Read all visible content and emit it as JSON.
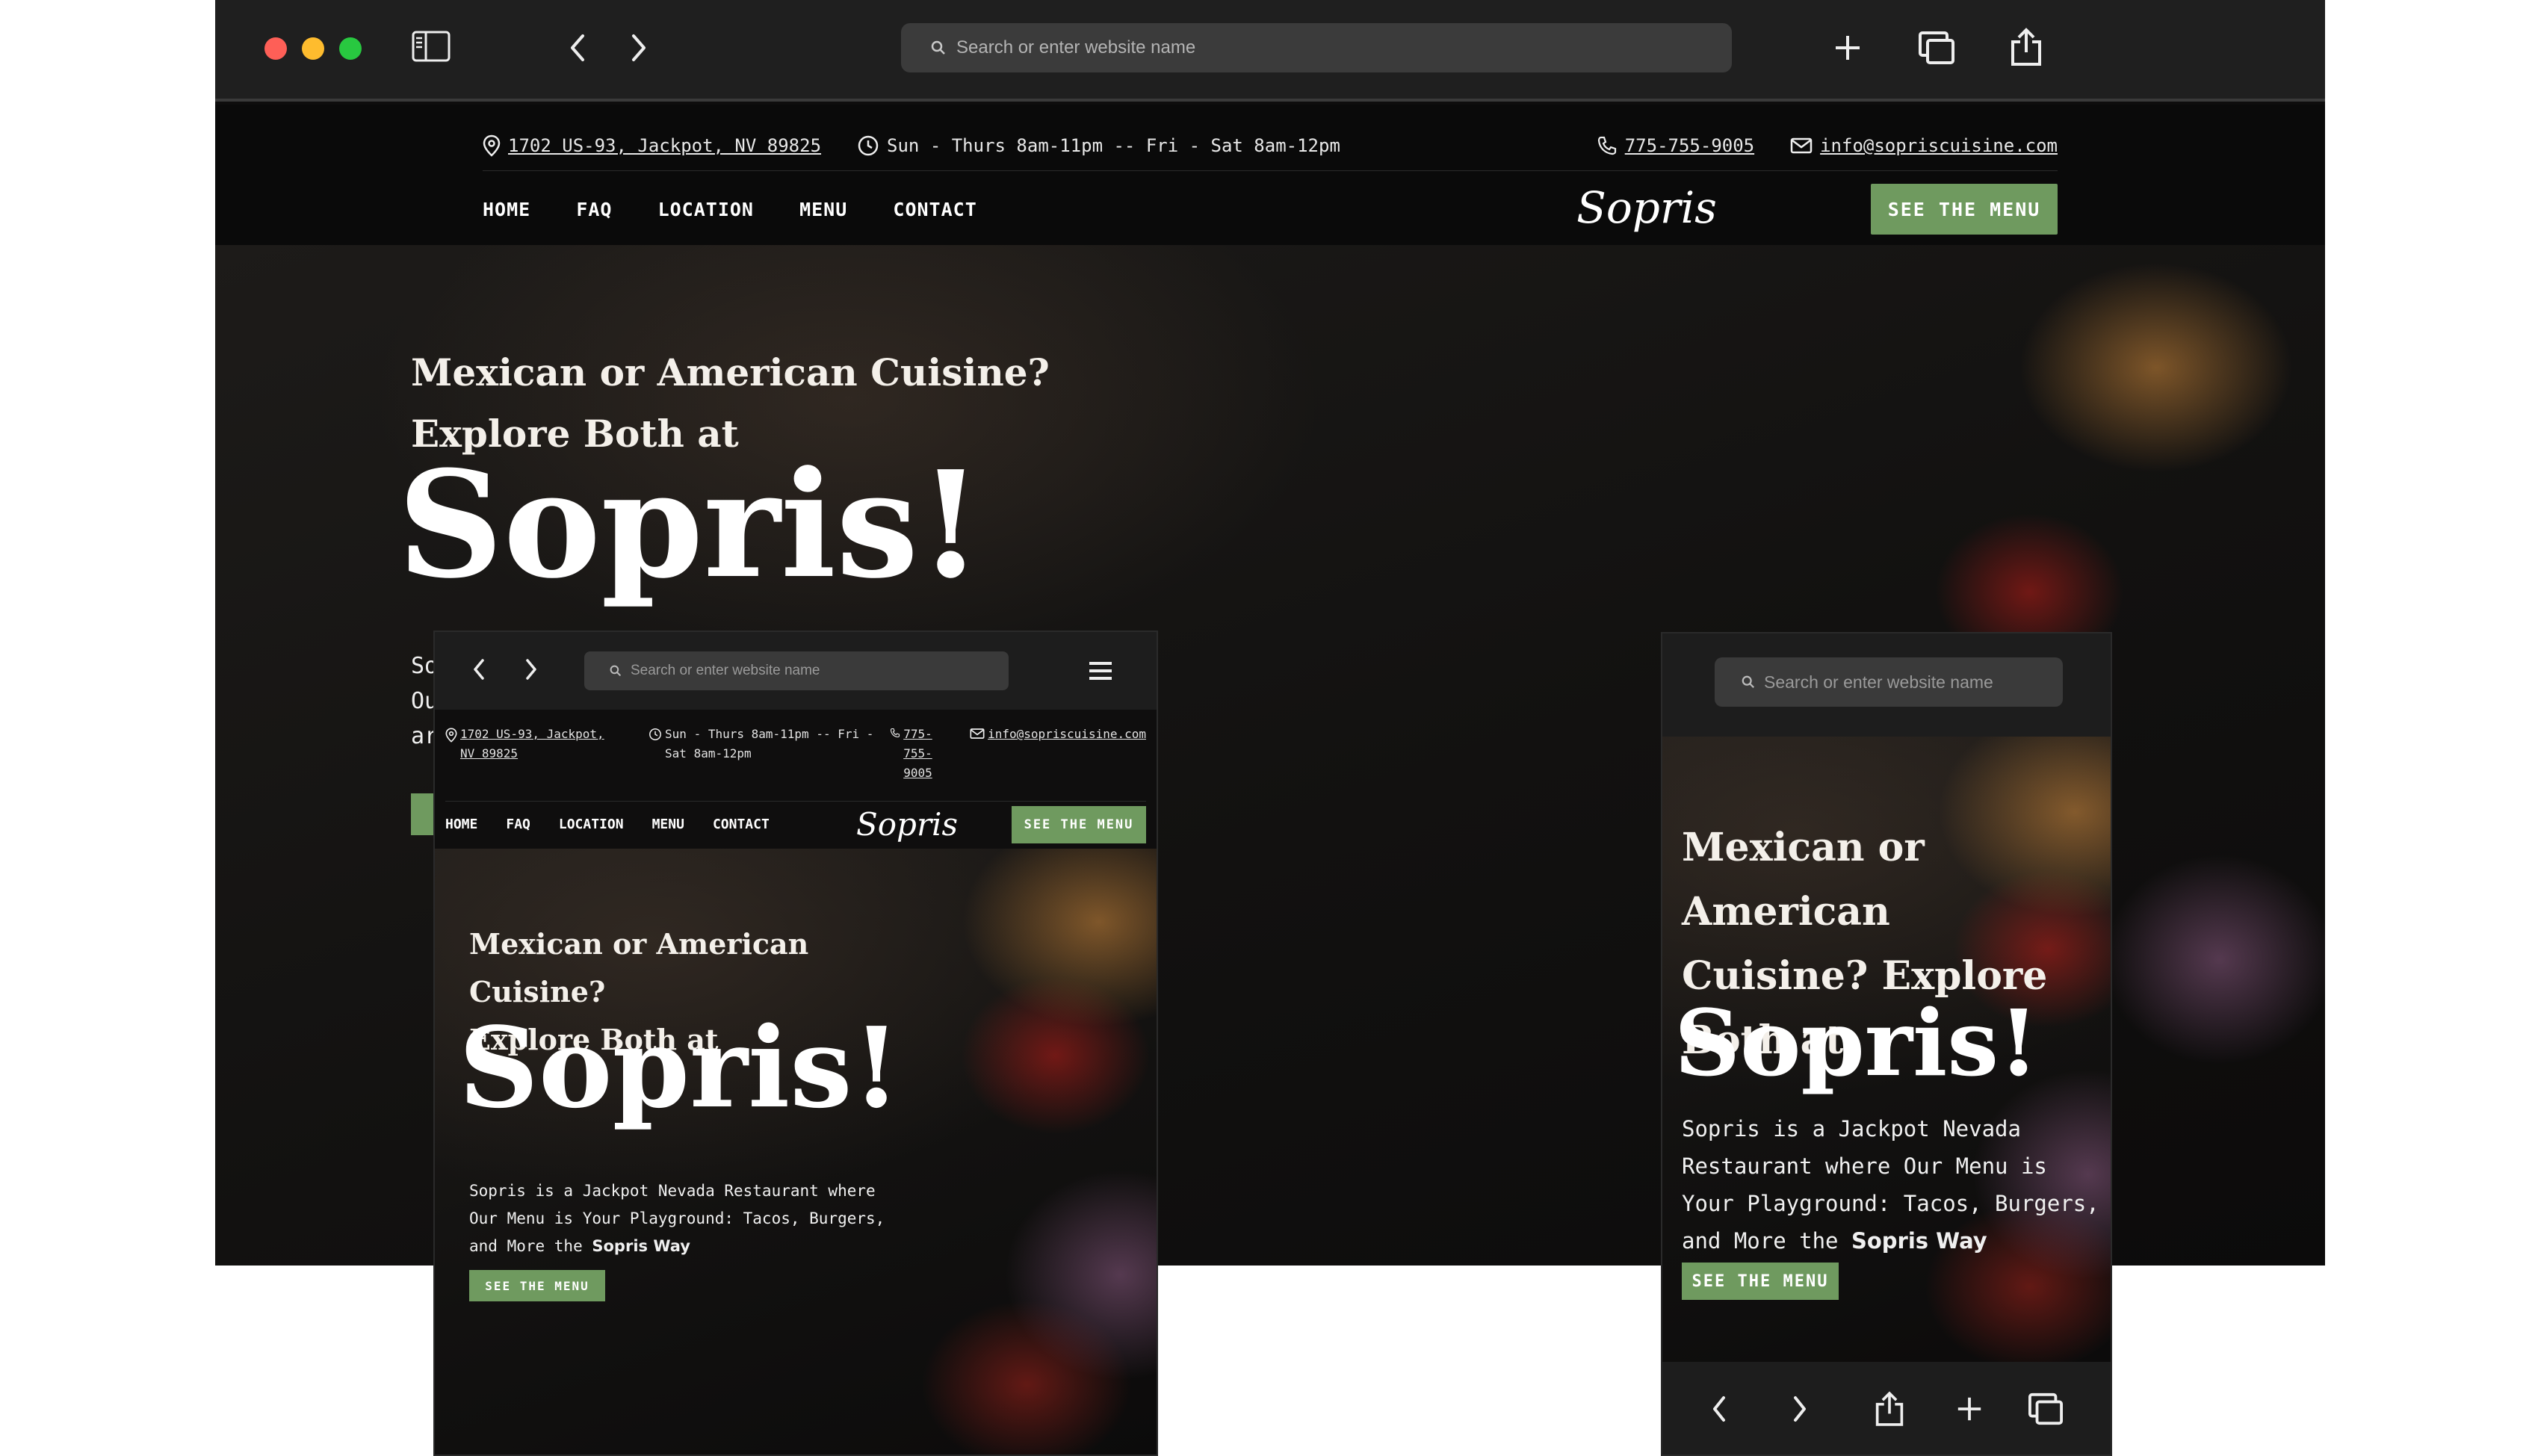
{
  "browser": {
    "search_placeholder": "Search or enter website name"
  },
  "site": {
    "address": "1702 US-93, Jackpot, NV 89825",
    "address_tablet": [
      "1702 US-93, Jackpot,",
      "NV 89825"
    ],
    "hours": "Sun - Thurs 8am-11pm -- Fri - Sat 8am-12pm",
    "hours_tablet": [
      "Sun - Thurs 8am-11pm -- Fri -",
      "Sat 8am-12pm"
    ],
    "phone": "775-755-9005",
    "phone_tablet": [
      "775-",
      "755-",
      "9005"
    ],
    "email": "info@sopriscuisine.com",
    "logo": "Sopris",
    "nav": [
      "HOME",
      "FAQ",
      "LOCATION",
      "MENU",
      "CONTACT"
    ],
    "cta": "SEE THE MENU",
    "hero": {
      "title": "Mexican or American Cuisine? Explore Both at",
      "title_lines": [
        "Mexican or American Cuisine?",
        "Explore Both at"
      ],
      "title_lines_phone": [
        "Mexican or American",
        "Cuisine? Explore",
        "Both at"
      ],
      "big": "Sopris!",
      "desc_prefix": "Sopris is a Jackpot Nevada Restaurant where Our Menu is Your Playground: Tacos, Burgers, and More the",
      "desc_bold": "Sopris Way",
      "desc_clip": [
        "So",
        "Ou",
        "ar"
      ]
    }
  },
  "colors": {
    "accent": "#6f9a5f",
    "dark": "#0e0d0d",
    "chrome": "#1f1f1f"
  },
  "icons": {
    "sidebar": "sidebar-icon",
    "back": "chevron-left-icon",
    "forward": "chevron-right-icon",
    "new_tab": "plus-icon",
    "tabs": "tabs-icon",
    "share": "share-icon",
    "search": "search-icon",
    "location": "map-pin-icon",
    "clock": "clock-icon",
    "phone": "phone-icon",
    "mail": "mail-icon",
    "menu": "hamburger-icon"
  }
}
